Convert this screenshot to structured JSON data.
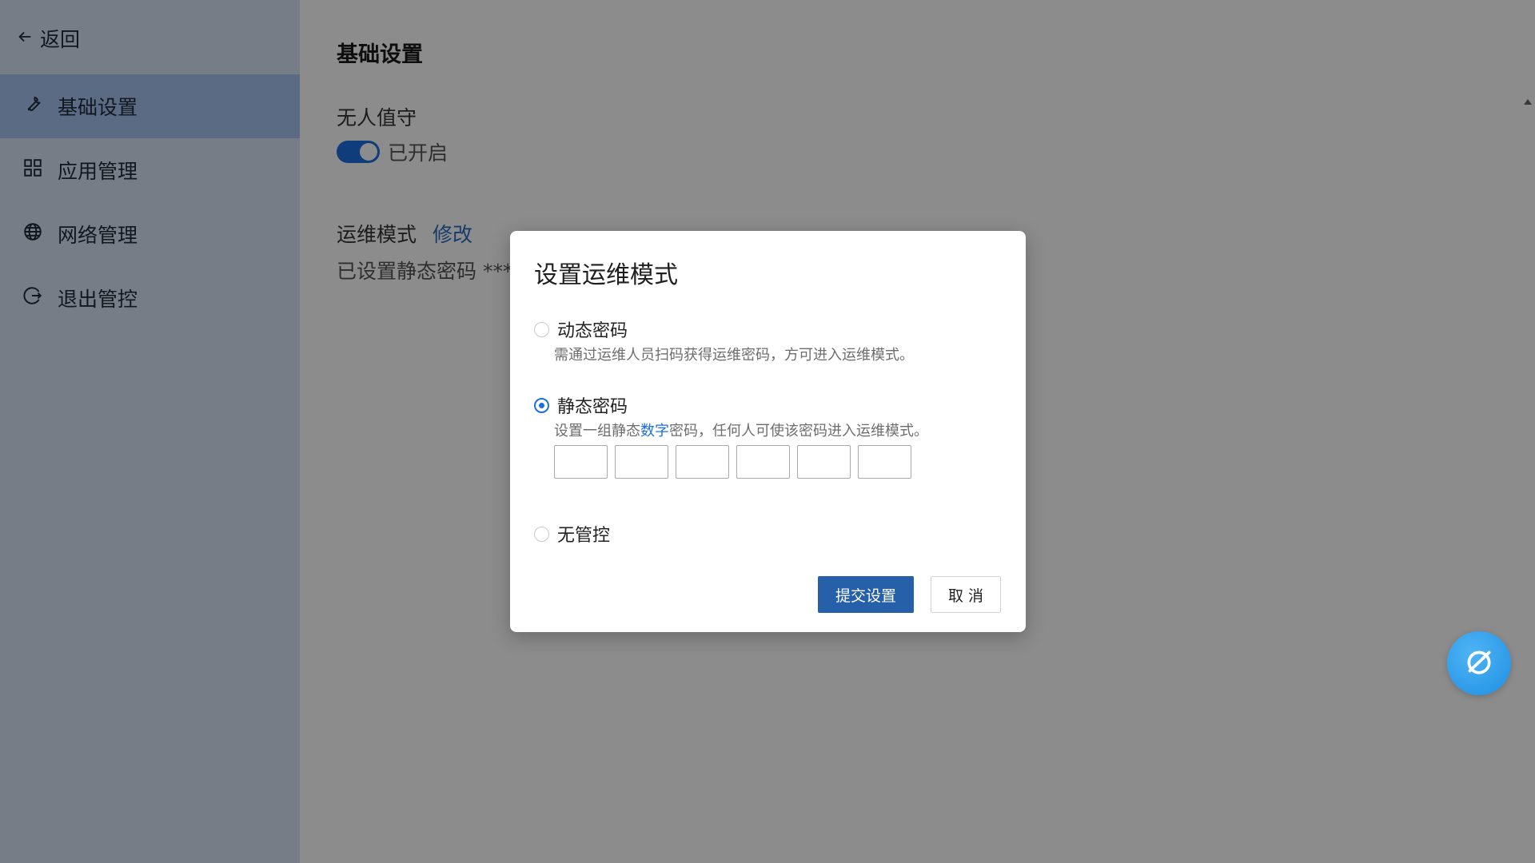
{
  "sidebar": {
    "back_label": "返回",
    "items": [
      {
        "label": "基础设置",
        "icon": "wrench-icon",
        "active": true
      },
      {
        "label": "应用管理",
        "icon": "apps-grid-icon",
        "active": false
      },
      {
        "label": "网络管理",
        "icon": "globe-icon",
        "active": false
      },
      {
        "label": "退出管控",
        "icon": "logout-icon",
        "active": false
      }
    ]
  },
  "main": {
    "title": "基础设置",
    "unattended_label": "无人值守",
    "toggle_state_label": "已开启",
    "ops_mode_label": "运维模式",
    "ops_mode_edit": "修改",
    "static_password_status": "已设置静态密码 ****"
  },
  "dialog": {
    "title": "设置运维模式",
    "options": [
      {
        "label": "动态密码",
        "desc": "需通过运维人员扫码获得运维密码，方可进入运维模式。",
        "checked": false
      },
      {
        "label": "静态密码",
        "desc_before": "设置一组静态",
        "desc_highlight": "数字",
        "desc_after": "密码，任何人可使该密码进入运维模式。",
        "checked": true
      },
      {
        "label": "无管控",
        "checked": false
      }
    ],
    "pin_length": 6,
    "submit_label": "提交设置",
    "cancel_label": "取 消"
  },
  "colors": {
    "sidebar_bg": "#d7e4f5",
    "active_item_bg": "#a6c4ee",
    "primary": "#1d6fe0",
    "submit_bg": "#2560a8",
    "overlay": "rgba(0,0,0,0.45)"
  }
}
